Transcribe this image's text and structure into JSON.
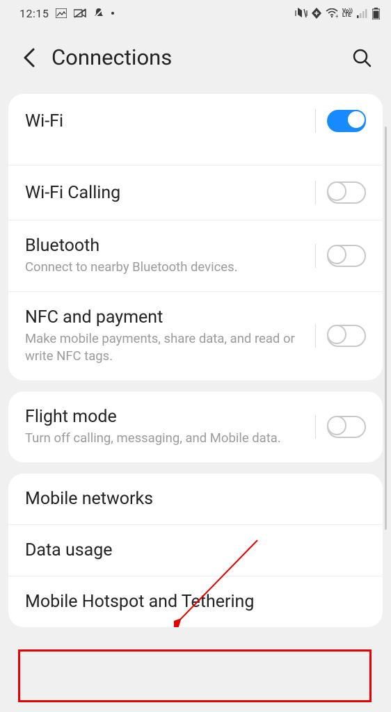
{
  "status": {
    "time": "12:15"
  },
  "header": {
    "title": "Connections"
  },
  "group1": {
    "wifi": {
      "label": "Wi-Fi",
      "on": true
    },
    "wifi_calling": {
      "label": "Wi-Fi Calling",
      "on": false
    },
    "bluetooth": {
      "label": "Bluetooth",
      "desc": "Connect to nearby Bluetooth devices.",
      "on": false
    },
    "nfc": {
      "label": "NFC and payment",
      "desc": "Make mobile payments, share data, and read or write NFC tags.",
      "on": false
    }
  },
  "group2": {
    "flight": {
      "label": "Flight mode",
      "desc": "Turn off calling, messaging, and Mobile data.",
      "on": false
    }
  },
  "group3": {
    "networks": {
      "label": "Mobile networks"
    },
    "data": {
      "label": "Data usage"
    },
    "hotspot": {
      "label": "Mobile Hotspot and Tethering"
    }
  }
}
